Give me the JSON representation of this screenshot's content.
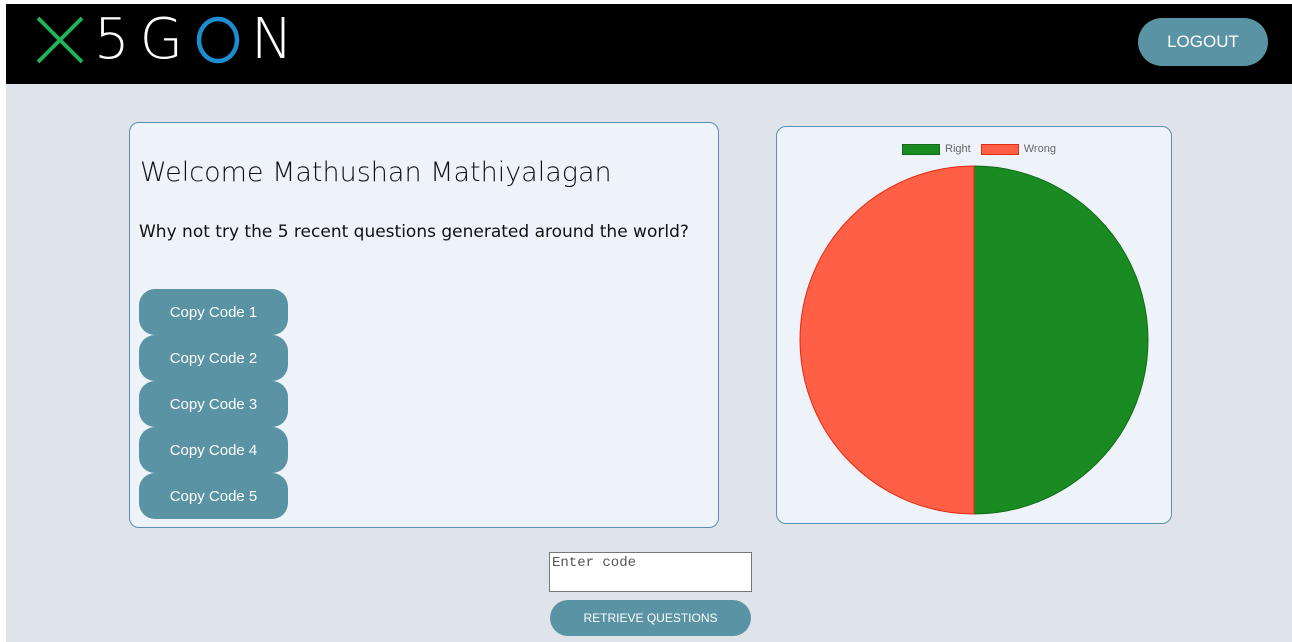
{
  "header": {
    "logo_text": "X5GON",
    "logo_letters": [
      "5",
      "G",
      "N"
    ],
    "logout_label": "LOGOUT"
  },
  "welcome": {
    "greeting": "Welcome Mathushan Mathiyalagan",
    "prompt": "Why not try the 5 recent questions generated around the world?"
  },
  "codes": [
    {
      "label": "Copy Code 1"
    },
    {
      "label": "Copy Code 2"
    },
    {
      "label": "Copy Code 3"
    },
    {
      "label": "Copy Code 4"
    },
    {
      "label": "Copy Code 5"
    }
  ],
  "chart_data": {
    "type": "pie",
    "labels": [
      "Right",
      "Wrong"
    ],
    "values": [
      1,
      1
    ],
    "colors": [
      "#1a8a22",
      "#fe5f45"
    ],
    "border_colors": [
      "#0f6b14",
      "#e82a10"
    ],
    "legend_position": "top"
  },
  "retrieve": {
    "input_placeholder": "Enter code",
    "input_value": "",
    "button_label": "RETRIEVE QUESTIONS"
  },
  "colors": {
    "accent": "#5a93a3",
    "logo_x": "#1fb35a",
    "logo_o": "#1c8ed0",
    "background": "#dfe3ea",
    "card": "#eef3fa"
  }
}
